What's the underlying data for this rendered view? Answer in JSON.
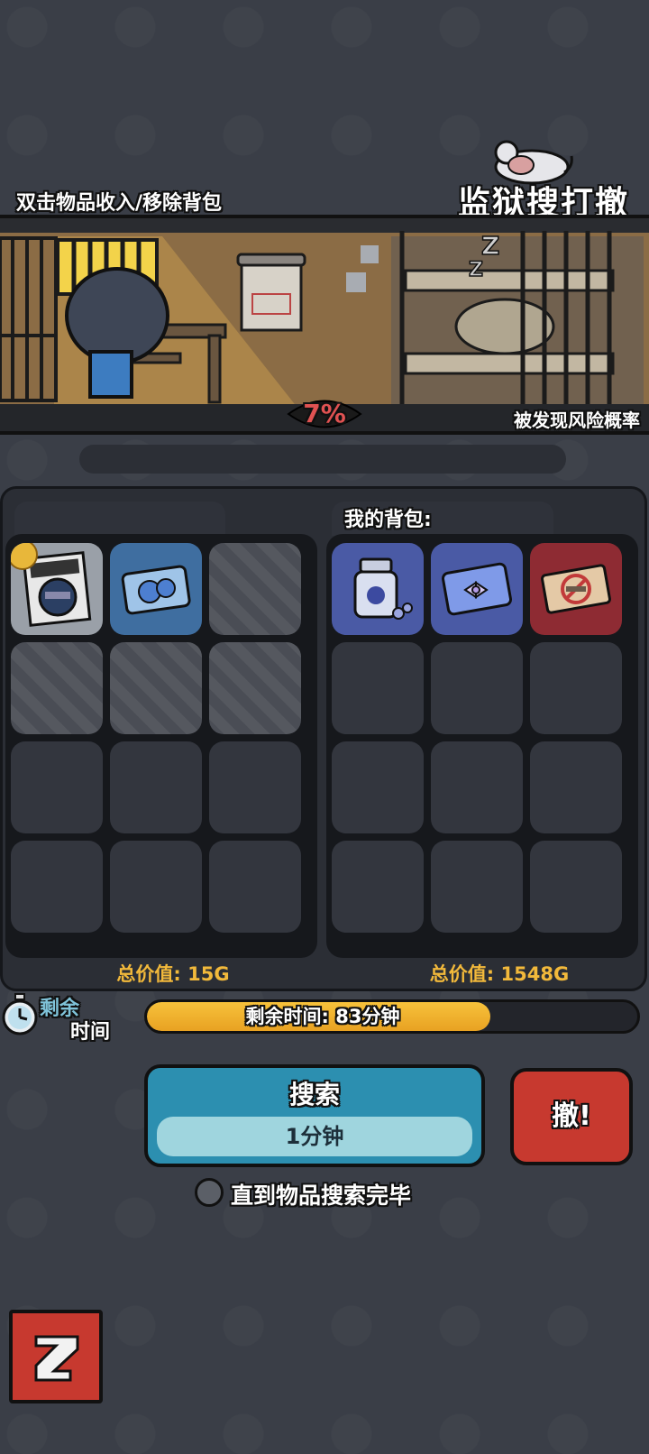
{
  "header": {
    "hint": "双击物品收入/移除背包",
    "logo": "监狱搜打撤"
  },
  "scene": {
    "risk_value": "7%",
    "risk_label": "被发现风险概率"
  },
  "backpack": {
    "title": "我的背包:",
    "items": [
      {
        "icon": "pill-bottle-icon",
        "color": "#4a5aa5"
      },
      {
        "icon": "toy-ticket-icon",
        "color": "#4a5aa5"
      },
      {
        "icon": "no-smoking-ticket-icon",
        "color": "#8e2b33"
      }
    ],
    "total": "总价值: 1548G"
  },
  "search_area": {
    "items": [
      {
        "icon": "magazine-icon",
        "color": "#9aa0a8"
      },
      {
        "icon": "blue-card-icon",
        "color": "#3f6ea0"
      }
    ],
    "total": "总价值: 15G"
  },
  "timer": {
    "label_line1": "剩余",
    "label_line2": "时间",
    "bar_text": "剩余时间: 83分钟",
    "progress": 0.7
  },
  "actions": {
    "search_label": "搜索",
    "search_time": "1分钟",
    "retreat_label": "撤!",
    "until_done_label": "直到物品搜索完毕"
  },
  "colors": {
    "background": "#3a3e47",
    "accent_gold": "#f2b93b",
    "search_blue": "#2c8fb0",
    "retreat_red": "#c7392f",
    "risk_red": "#e05252"
  }
}
